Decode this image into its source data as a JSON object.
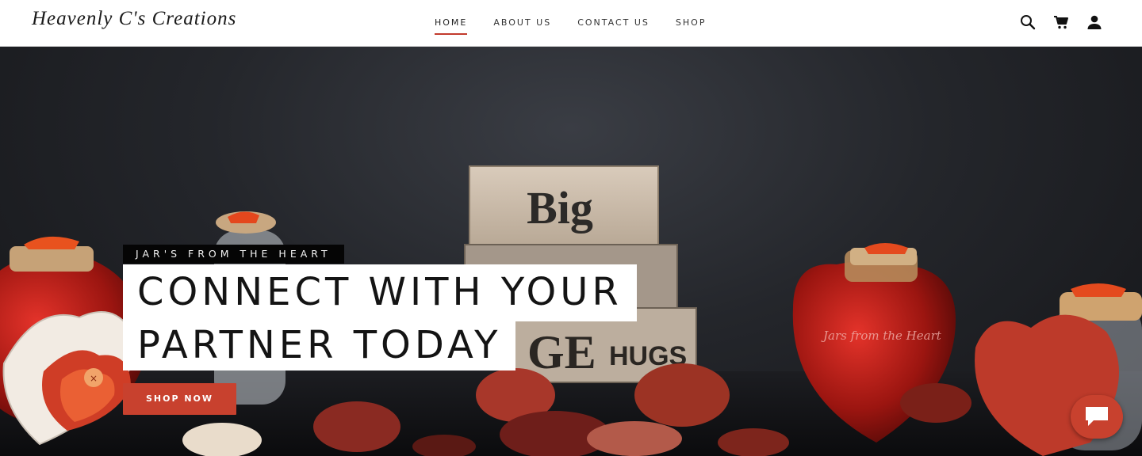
{
  "brand": {
    "name": "Heavenly C's Creations"
  },
  "nav": {
    "items": [
      {
        "label": "HOME",
        "active": true
      },
      {
        "label": "ABOUT US",
        "active": false
      },
      {
        "label": "CONTACT US",
        "active": false
      },
      {
        "label": "SHOP",
        "active": false
      }
    ]
  },
  "header_icons": [
    "search-icon",
    "cart-icon",
    "account-icon"
  ],
  "hero": {
    "eyebrow": "JAR'S FROM THE HEART",
    "headline_line1": "CONNECT WITH YOUR",
    "headline_line2": "PARTNER TODAY",
    "cta_label": "SHOP NOW",
    "block_words": [
      "Big",
      "&",
      "GE",
      "HUGS"
    ],
    "jar_writing": "Jars from the Heart"
  },
  "colors": {
    "accent": "#c8412e",
    "nav_underline": "#c23a2c",
    "hero_background": "#24262b"
  },
  "chat": {
    "icon": "chat-icon"
  }
}
